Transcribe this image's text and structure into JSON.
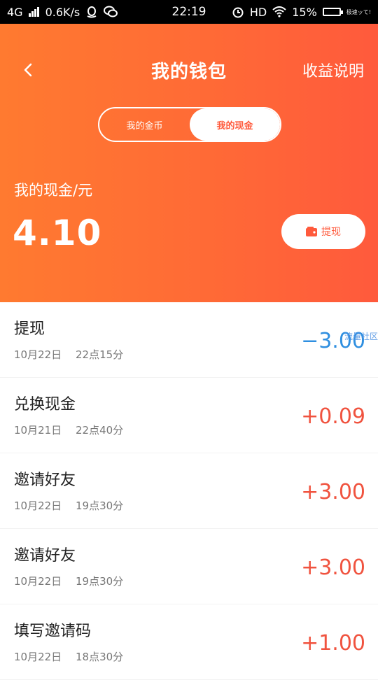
{
  "status_bar": {
    "network": "4G",
    "speed": "0.6K/s",
    "time": "22:19",
    "hd": "HD",
    "battery_pct": "15%",
    "battery_fill": 0.15,
    "battery_note": "极速ッて!"
  },
  "header": {
    "title": "我的钱包",
    "right_link": "收益说明",
    "tabs": [
      "我的金币",
      "我的现金"
    ],
    "balance_label": "我的现金/元",
    "balance_value": "4.10",
    "withdraw_label": "提现"
  },
  "colors": {
    "gradient_start": "#ff7a30",
    "gradient_end": "#ff5a3c",
    "positive": "#f0533f",
    "negative": "#2f8fe0"
  },
  "transactions": [
    {
      "title": "提现",
      "date": "10月22日",
      "time": "22点15分",
      "amount": "−3.00",
      "sign": "neg",
      "overlay": "流量社区"
    },
    {
      "title": "兑换现金",
      "date": "10月21日",
      "time": "22点40分",
      "amount": "+0.09",
      "sign": "pos"
    },
    {
      "title": "邀请好友",
      "date": "10月22日",
      "time": "19点30分",
      "amount": "+3.00",
      "sign": "pos"
    },
    {
      "title": "邀请好友",
      "date": "10月22日",
      "time": "19点30分",
      "amount": "+3.00",
      "sign": "pos"
    },
    {
      "title": "填写邀请码",
      "date": "10月22日",
      "time": "18点30分",
      "amount": "+1.00",
      "sign": "pos"
    }
  ]
}
